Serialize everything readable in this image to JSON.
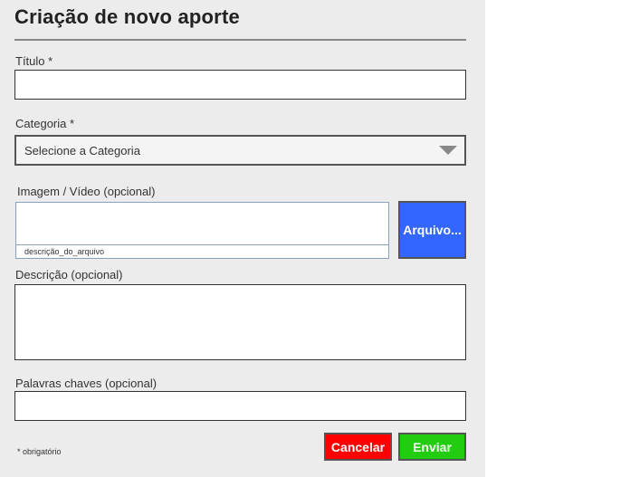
{
  "form": {
    "title": "Criação de novo aporte",
    "titulo": {
      "label": "Título *",
      "value": ""
    },
    "categoria": {
      "label": "Categoria *",
      "selected": "Selecione a Categoria"
    },
    "imagem": {
      "label": "Imagem / Vídeo (opcional)",
      "file_name": "descrição_do_arquivo",
      "button_label": "Arquivo..."
    },
    "descricao": {
      "label": "Descrição (opcional)",
      "value": ""
    },
    "palavras": {
      "label": "Palavras chaves (opcional)",
      "value": ""
    },
    "required_note": "* obrigatório",
    "cancel_label": "Cancelar",
    "send_label": "Enviar"
  },
  "colors": {
    "panel_bg": "#ececec",
    "file_button": "#3366ff",
    "cancel_button": "#ff0000",
    "send_button": "#22cc11"
  },
  "icons": {
    "select_arrow": "chevron-down-icon"
  }
}
